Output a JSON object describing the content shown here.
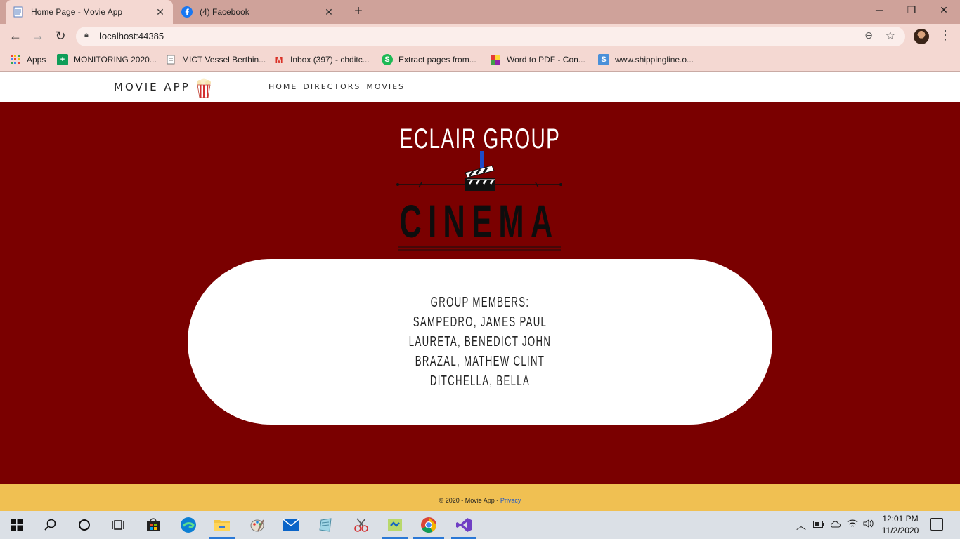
{
  "browser": {
    "tabs": [
      {
        "title": "Home Page - Movie App",
        "icon": "document-icon"
      },
      {
        "title": "(4) Facebook",
        "icon": "facebook-icon"
      }
    ],
    "new_tab_label": "+",
    "url": "localhost:44385",
    "bookmarks": [
      {
        "label": "Apps",
        "icon": "apps-grid-icon"
      },
      {
        "label": "MONITORING 2020...",
        "icon": "sheets-icon"
      },
      {
        "label": "MICT Vessel Berthin...",
        "icon": "document-icon"
      },
      {
        "label": "Inbox (397) - chditc...",
        "icon": "gmail-icon"
      },
      {
        "label": "Extract pages from...",
        "icon": "smallpdf-icon"
      },
      {
        "label": "Word to PDF - Con...",
        "icon": "colorful-grid-icon"
      },
      {
        "label": "www.shippingline.o...",
        "icon": "s-icon"
      }
    ]
  },
  "site": {
    "brand": "MOVIE APP",
    "nav": [
      "HOME",
      "DIRECTORS",
      "MOVIES"
    ],
    "hero_title": "ECLAIR GROUP",
    "logo_text": "CINEMA",
    "members": [
      "GROUP MEMBERS:",
      "SAMPEDRO, JAMES PAUL",
      "LAURETA, BENEDICT JOHN",
      "BRAZAL, MATHEW CLINT",
      "DITCHELLA, BELLA"
    ],
    "footer_text": "© 2020 - Movie App - ",
    "footer_link": "Privacy"
  },
  "taskbar": {
    "time": "12:01 PM",
    "date": "11/2/2020"
  },
  "colors": {
    "page_bg": "#7a0000",
    "footer_bg": "#f0c052",
    "chrome_frame": "#cfa29a",
    "link": "#1a55c8"
  }
}
